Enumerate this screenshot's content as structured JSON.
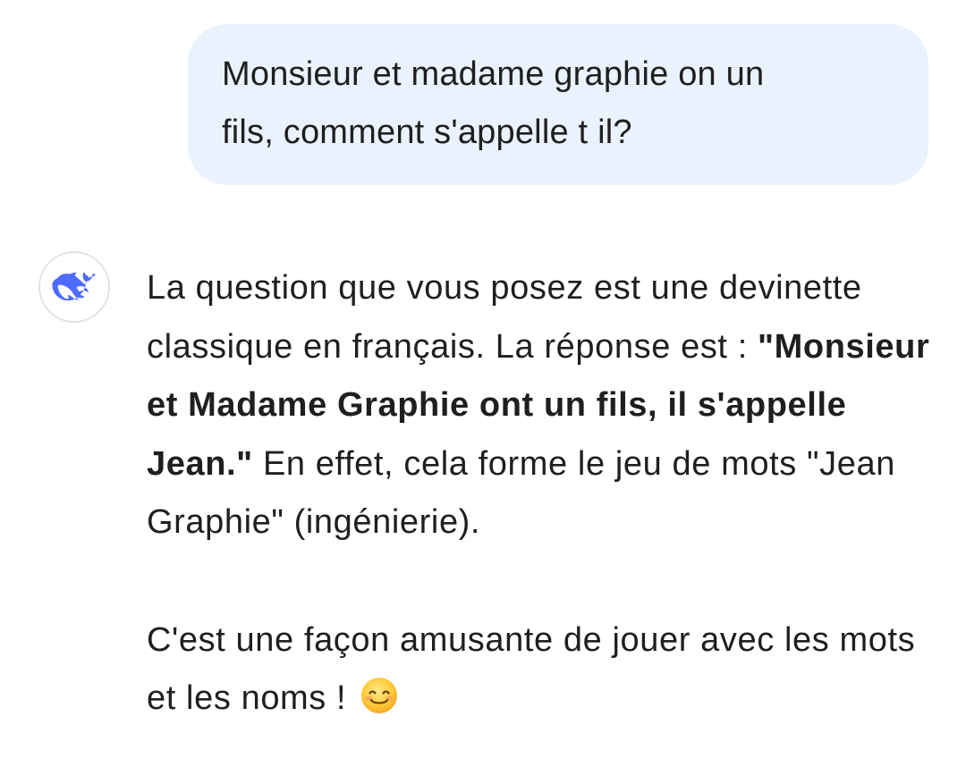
{
  "user_message": {
    "line1": "Monsieur et madame graphie on un",
    "line2": "fils, comment s'appelle t il?"
  },
  "assistant": {
    "avatar_icon": "deepseek-whale-icon",
    "accent_color": "#4d6bfe",
    "paragraph1": {
      "text_before": "La question que vous posez est une devinette classique en français. La réponse est : ",
      "bold_text": "\"Monsieur et Madame Graphie ont un fils, il s'appelle Jean.\"",
      "text_after": " En effet, cela forme le jeu de mots \"Jean Graphie\" (ingénierie)."
    },
    "paragraph2": {
      "text": "C'est une façon amusante de jouer avec les mots et les noms !",
      "emoji_icon": "smiling-face-emoji-icon"
    }
  },
  "colors": {
    "user_bubble_bg": "#eaf2fd",
    "text": "#1f1f1f"
  }
}
